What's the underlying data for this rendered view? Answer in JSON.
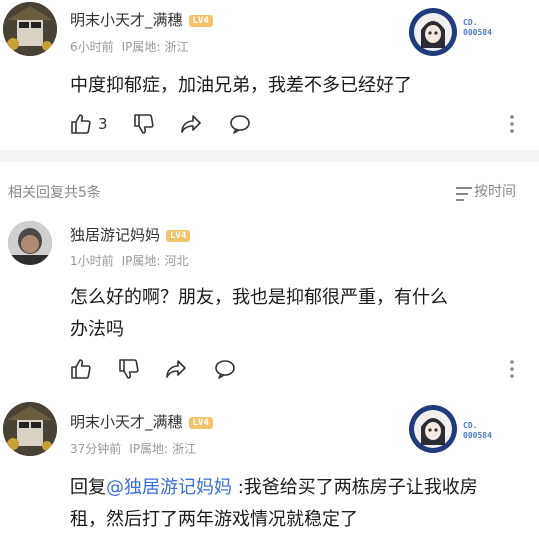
{
  "comment1": {
    "username": "明末小天才_满穗",
    "level": "LV4",
    "time": "6小时前",
    "ip_label": "IP属地:",
    "ip_location": "浙江",
    "text": "中度抑郁症，加油兄弟，我差不多已经好了",
    "like_count": "3",
    "medal_line1": "CD.",
    "medal_line2": "000584"
  },
  "replies_header": {
    "title": "相关回复共5条",
    "sort_label": "按时间"
  },
  "reply1": {
    "username": "独居游记妈妈",
    "level": "LV4",
    "time": "1小时前",
    "ip_label": "IP属地:",
    "ip_location": "河北",
    "text": "怎么好的啊？朋友，我也是抑郁很严重，有什么办法吗"
  },
  "reply2": {
    "username": "明末小天才_满穗",
    "level": "LV4",
    "time": "37分钟前",
    "ip_label": "IP属地:",
    "ip_location": "浙江",
    "reply_prefix": "回复",
    "mention": "@独居游记妈妈",
    "text": " :我爸给买了两栋房子让我收房租，然后打了两年游戏情况就稳定了",
    "medal_line1": "CD.",
    "medal_line2": "000584"
  }
}
